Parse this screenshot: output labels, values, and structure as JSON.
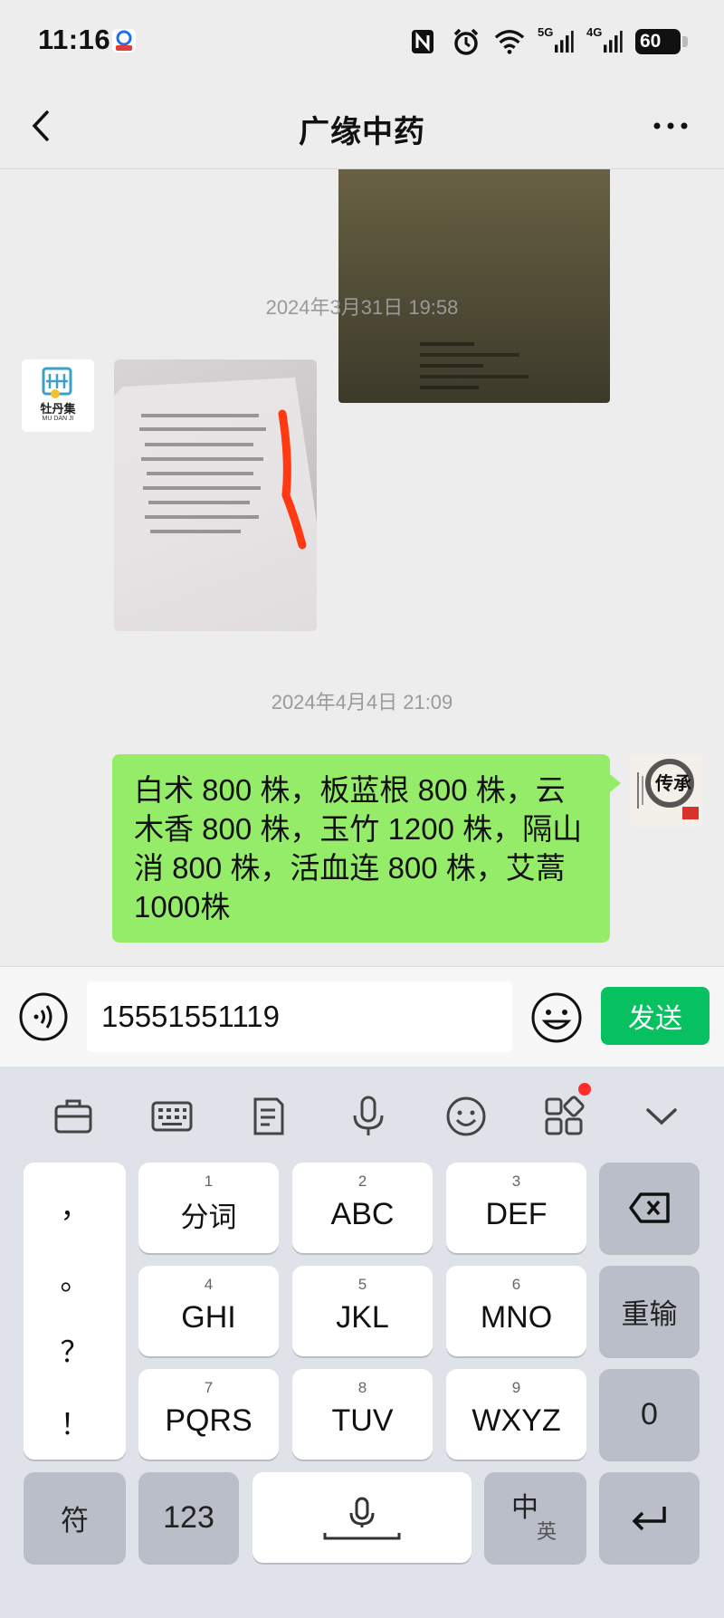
{
  "status_bar": {
    "time": "11:16",
    "network_5g": "5G",
    "network_4g": "4G",
    "battery": "60"
  },
  "nav": {
    "title": "广缘中药"
  },
  "chat": {
    "timestamps": [
      "2024年3月31日 19:58",
      "2024年4月4日 21:09"
    ],
    "left_avatar_text": "牡丹集",
    "left_avatar_subtext": "MU DAN JI",
    "right_avatar_text": "传承",
    "outgoing_message": "白术 800 株，板蓝根 800 株，云木香 800 株，玉竹 1200 株，隔山消 800 株，活血连 800 株，艾蒿 1000株"
  },
  "input_bar": {
    "value": "15551551119",
    "send_label": "发送"
  },
  "keyboard": {
    "punctuation": [
      "，",
      "。",
      "？",
      "！"
    ],
    "keys": [
      {
        "num": "1",
        "label": "分词"
      },
      {
        "num": "2",
        "label": "ABC"
      },
      {
        "num": "3",
        "label": "DEF"
      },
      {
        "num": "4",
        "label": "GHI"
      },
      {
        "num": "5",
        "label": "JKL"
      },
      {
        "num": "6",
        "label": "MNO"
      },
      {
        "num": "7",
        "label": "PQRS"
      },
      {
        "num": "8",
        "label": "TUV"
      },
      {
        "num": "9",
        "label": "WXYZ"
      }
    ],
    "reinput_label": "重输",
    "zero_label": "0",
    "symbol_label": "符",
    "numeric_label": "123",
    "lang_main": "中",
    "lang_sub": "英"
  },
  "colors": {
    "accent_green": "#07c160",
    "bubble_green": "#95ec69",
    "notification_dot": "#ff2d2d"
  },
  "icons": [
    "back-arrow-icon",
    "more-icon",
    "voice-icon",
    "emoji-icon",
    "briefcase-icon",
    "keyboard-icon",
    "clipboard-icon",
    "mic-icon",
    "smiley-icon",
    "apps-icon",
    "chevron-down-icon",
    "backspace-icon",
    "enter-icon",
    "nfc-icon",
    "alarm-icon",
    "wifi-icon",
    "signal-icon"
  ]
}
